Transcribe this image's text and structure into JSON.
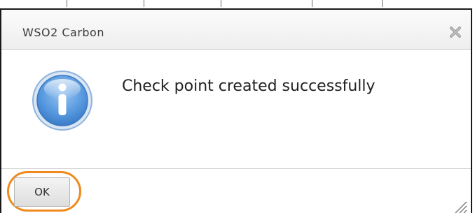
{
  "dialog": {
    "title": "WSO2 Carbon",
    "message": "Check point created successfully",
    "ok_label": "OK",
    "icons": {
      "close": "close-icon",
      "info": "info-icon",
      "resize": "resize-grip-icon"
    },
    "colors": {
      "highlight": "#f08a1c",
      "info_icon": "#4a8fd8"
    }
  }
}
